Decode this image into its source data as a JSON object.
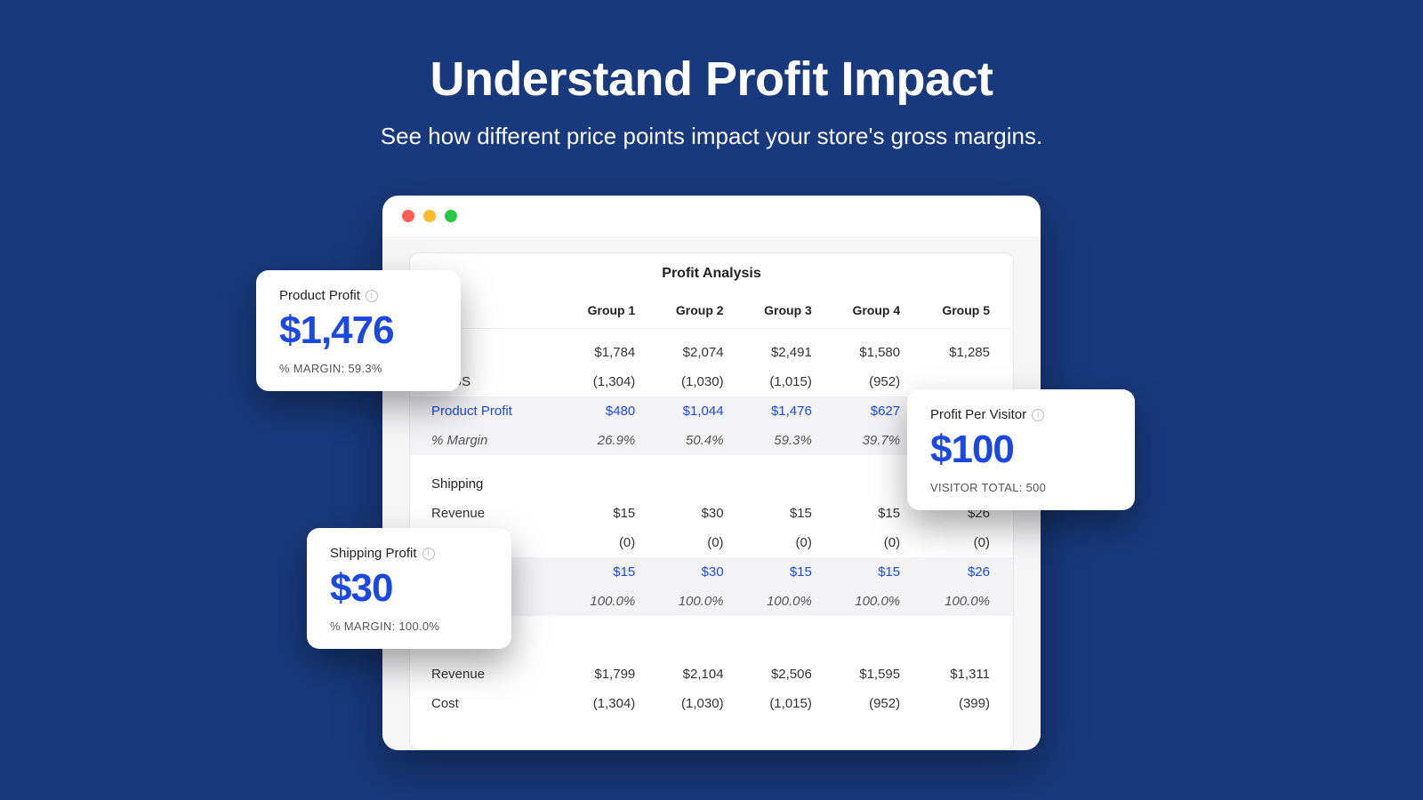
{
  "hero": {
    "title": "Understand Profit Impact",
    "subtitle": "See how different price points impact your store's gross margins."
  },
  "card": {
    "title": "Profit Analysis"
  },
  "columns": [
    "Group 1",
    "Group 2",
    "Group 3",
    "Group 4",
    "Group 5"
  ],
  "rows": {
    "r1": {
      "label": "",
      "cells": [
        "$1,784",
        "$2,074",
        "$2,491",
        "$1,580",
        "$1,285"
      ]
    },
    "cogs": {
      "label": "COGS",
      "cells": [
        "(1,304)",
        "(1,030)",
        "(1,015)",
        "(952)",
        ""
      ]
    },
    "pp": {
      "label": "Product Profit",
      "cells": [
        "$480",
        "$1,044",
        "$1,476",
        "$627",
        ""
      ]
    },
    "pm": {
      "label": "% Margin",
      "cells": [
        "26.9%",
        "50.4%",
        "59.3%",
        "39.7%",
        ""
      ]
    },
    "ship_sec": {
      "label": "Shipping"
    },
    "srev": {
      "label": "Revenue",
      "cells": [
        "$15",
        "$30",
        "$15",
        "$15",
        "$26"
      ]
    },
    "sc": {
      "label": "",
      "cells": [
        "(0)",
        "(0)",
        "(0)",
        "(0)",
        "(0)"
      ]
    },
    "sp": {
      "label": "",
      "cells": [
        "$15",
        "$30",
        "$15",
        "$15",
        "$26"
      ]
    },
    "sm": {
      "label": "",
      "cells": [
        "100.0%",
        "100.0%",
        "100.0%",
        "100.0%",
        "100.0%"
      ]
    },
    "trev": {
      "label": "Revenue",
      "cells": [
        "$1,799",
        "$2,104",
        "$2,506",
        "$1,595",
        "$1,311"
      ]
    },
    "tcost": {
      "label": "Cost",
      "cells": [
        "(1,304)",
        "(1,030)",
        "(1,015)",
        "(952)",
        "(399)"
      ]
    }
  },
  "floats": {
    "productProfit": {
      "label": "Product Profit",
      "value": "$1,476",
      "sub": "% MARGIN: 59.3%"
    },
    "shippingProfit": {
      "label": "Shipping Profit",
      "value": "$30",
      "sub": "% MARGIN: 100.0%"
    },
    "profitPerVisitor": {
      "label": "Profit Per Visitor",
      "value": "$100",
      "sub": "VISITOR TOTAL: 500"
    }
  }
}
